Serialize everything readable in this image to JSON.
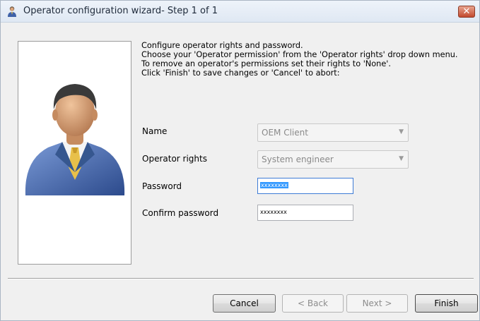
{
  "window": {
    "title": "Operator configuration wizard- Step 1 of 1",
    "close_glyph": "✕"
  },
  "instructions": [
    "Configure operator rights and password.",
    "Choose your 'Operator permission' from the 'Operator rights' drop down menu.",
    "To remove an operator's permissions set their rights to 'None'.",
    "Click 'Finish' to save changes or 'Cancel' to abort:"
  ],
  "form": {
    "name": {
      "label": "Name",
      "value": "OEM Client",
      "enabled": false
    },
    "operator_rights": {
      "label": "Operator rights",
      "value": "System engineer",
      "enabled": false
    },
    "password": {
      "label": "Password",
      "value": "xxxxxxxx",
      "selected": true
    },
    "confirm_password": {
      "label": "Confirm password",
      "value": "xxxxxxxx"
    }
  },
  "buttons": {
    "cancel": "Cancel",
    "back": "< Back",
    "next": "Next >",
    "finish": "Finish"
  },
  "icons": {
    "title": "operator-person-icon",
    "portrait": "businessman-avatar",
    "dropdown": "chevron-down-icon"
  },
  "colors": {
    "selection": "#3399ff",
    "close_button": "#c24a2e",
    "suit": "#3f62a8"
  }
}
